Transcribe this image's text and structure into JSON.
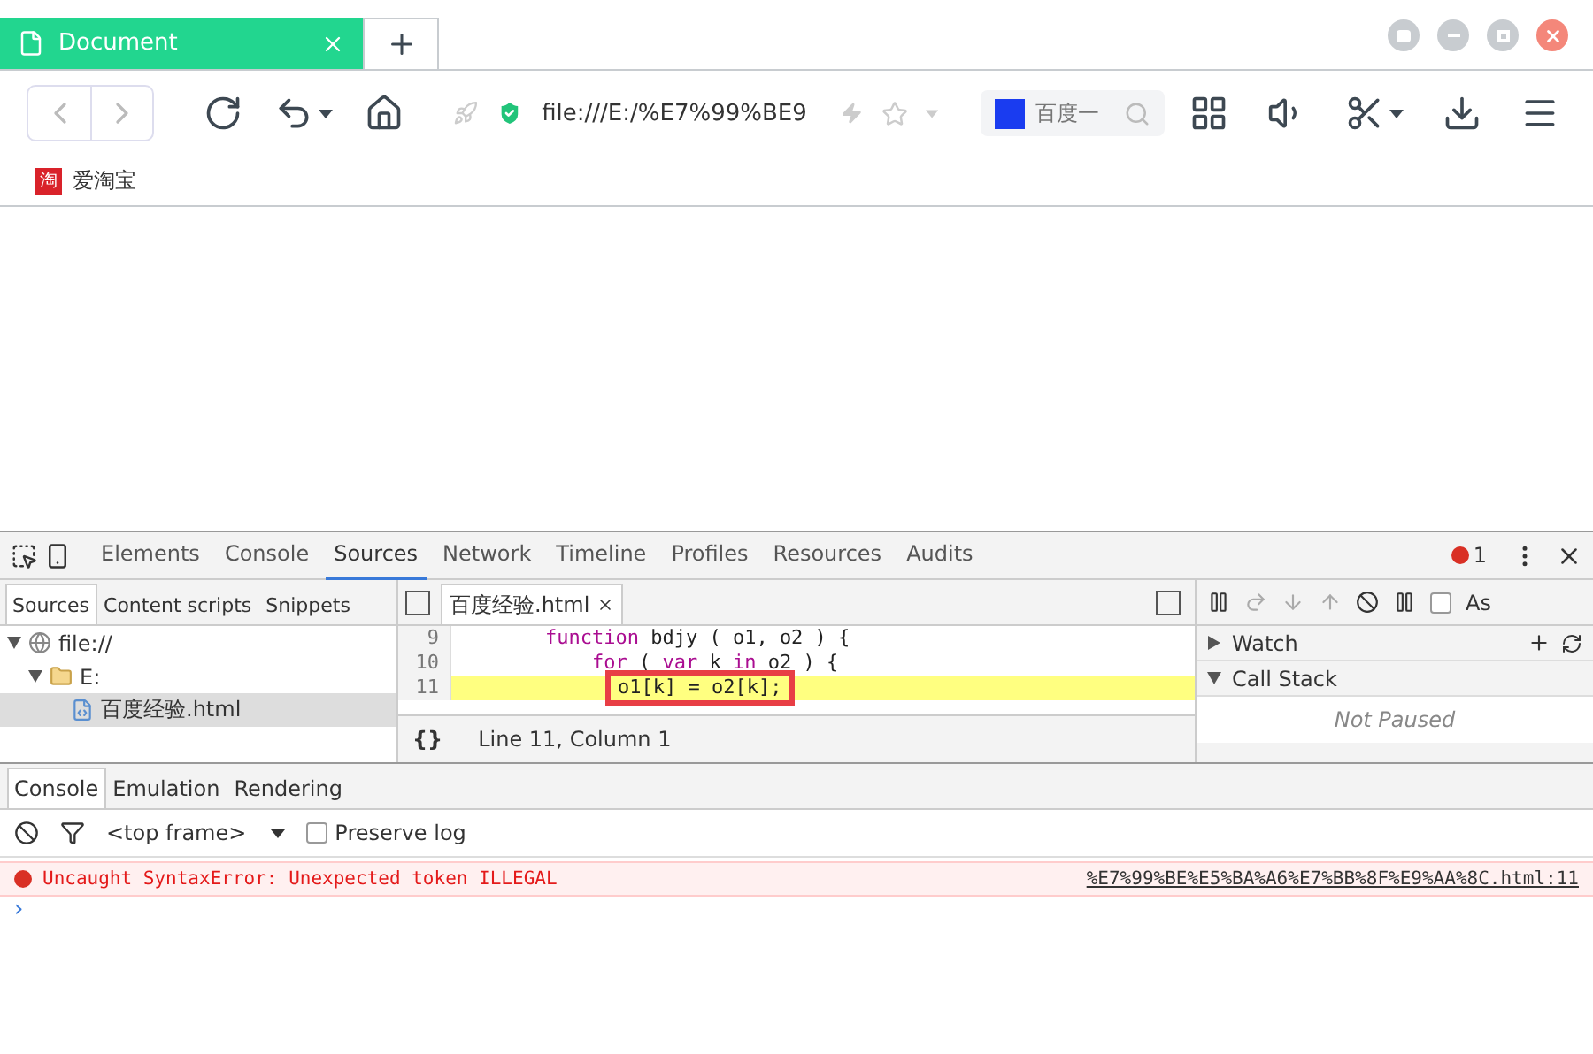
{
  "browser": {
    "tabs": [
      {
        "title": "Document",
        "selected": true
      }
    ],
    "address": "file:///E:/%E7%99%BE9",
    "search_placeholder": "百度一",
    "bookmarks": [
      {
        "label": "爱淘宝",
        "badge": "淘"
      }
    ]
  },
  "devtools": {
    "panels": [
      {
        "label": "Elements",
        "selected": false
      },
      {
        "label": "Console",
        "selected": false
      },
      {
        "label": "Sources",
        "selected": true
      },
      {
        "label": "Network",
        "selected": false
      },
      {
        "label": "Timeline",
        "selected": false
      },
      {
        "label": "Profiles",
        "selected": false
      },
      {
        "label": "Resources",
        "selected": false
      },
      {
        "label": "Audits",
        "selected": false
      }
    ],
    "error_count": "1",
    "navigator": {
      "tabs": [
        {
          "label": "Sources",
          "selected": true
        },
        {
          "label": "Content scripts",
          "selected": false
        },
        {
          "label": "Snippets",
          "selected": false
        }
      ],
      "tree": [
        {
          "label": "file://",
          "kind": "origin",
          "expanded": true,
          "selected": false,
          "children": [
            {
              "label": "E:",
              "kind": "folder",
              "expanded": true,
              "selected": false,
              "children": [
                {
                  "label": "百度经验.html",
                  "kind": "file",
                  "selected": true
                }
              ]
            }
          ]
        }
      ]
    },
    "editor": {
      "file_tab": "百度经验.html",
      "lines": [
        {
          "number": "9",
          "highlighted": false,
          "tokens": [
            {
              "kind": "keyword",
              "text": "        function"
            },
            {
              "kind": "plain",
              "text": " bdjy ( o1, o2 ) {"
            }
          ]
        },
        {
          "number": "10",
          "highlighted": false,
          "tokens": [
            {
              "kind": "keyword",
              "text": "            for"
            },
            {
              "kind": "plain",
              "text": " ( "
            },
            {
              "kind": "keyword",
              "text": "var"
            },
            {
              "kind": "plain",
              "text": " k "
            },
            {
              "kind": "keyword",
              "text": "in"
            },
            {
              "kind": "plain",
              "text": " o2 ) {"
            }
          ]
        },
        {
          "number": "11",
          "highlighted": true,
          "tokens": [
            {
              "kind": "boxed",
              "text": "o1[k] = o2[k];"
            }
          ]
        }
      ],
      "status": "Line 11, Column 1",
      "format_button": "{}"
    },
    "debugger": {
      "async_label": "As",
      "async_checked": false,
      "sections": [
        {
          "title": "Watch",
          "expanded": false
        },
        {
          "title": "Call Stack",
          "expanded": true,
          "message": "Not Paused"
        }
      ]
    },
    "drawer": {
      "tabs": [
        {
          "label": "Console",
          "selected": true
        },
        {
          "label": "Emulation",
          "selected": false
        },
        {
          "label": "Rendering",
          "selected": false
        }
      ],
      "context": "<top frame>",
      "preserve_log": {
        "label": "Preserve log",
        "checked": false
      },
      "messages": [
        {
          "kind": "error",
          "text": "Uncaught SyntaxError: Unexpected token ILLEGAL",
          "source": "%E7%99%BE%E5%BA%A6%E7%BB%8F%E9%AA%8C.html:11"
        }
      ],
      "prompt": "›"
    }
  }
}
